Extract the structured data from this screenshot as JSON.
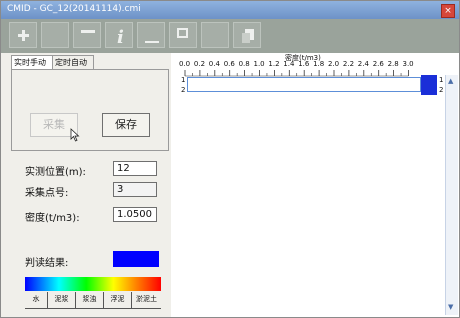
{
  "window": {
    "title": "CMID - GC_12(20141114).cmi",
    "close_glyph": "×"
  },
  "toolbar": {
    "buttons": [
      {
        "icon": "upload-icon"
      },
      {
        "icon": "blank-icon"
      },
      {
        "icon": "minimize-icon"
      },
      {
        "icon": "info-icon",
        "glyph": "i"
      },
      {
        "icon": "dash-icon"
      },
      {
        "icon": "window-icon"
      },
      {
        "icon": "blank-icon"
      },
      {
        "icon": "copy-icon"
      }
    ]
  },
  "left_panel": {
    "tabs": [
      "实时手动",
      "定时自动"
    ],
    "collect_label": "采集",
    "save_label": "保存",
    "fields": {
      "position_label": "实测位置(m):",
      "position_value": "12",
      "point_label": "采集点号:",
      "point_value": "3",
      "density_label": "密度(t/m3):",
      "density_value": "1.0500"
    },
    "result_label": "判读结果:",
    "result_color": "#0000ff",
    "legend": [
      "水",
      "泥浆",
      "浆浊",
      "浮泥",
      "淤泥土"
    ]
  },
  "right_panel": {
    "axis_title": "密度(t/m3)",
    "ticks": [
      "0.0",
      "0.2",
      "0.4",
      "0.6",
      "0.8",
      "1.0",
      "1.2",
      "1.4",
      "1.6",
      "1.8",
      "2.0",
      "2.2",
      "2.4",
      "2.6",
      "2.8",
      "3.0"
    ],
    "row_labels_left": [
      "1",
      "2"
    ],
    "row_labels_right": [
      "1",
      "2"
    ],
    "bar_color": "#1a2fd8",
    "scroll_up_glyph": "▲",
    "scroll_down_glyph": "▼"
  }
}
